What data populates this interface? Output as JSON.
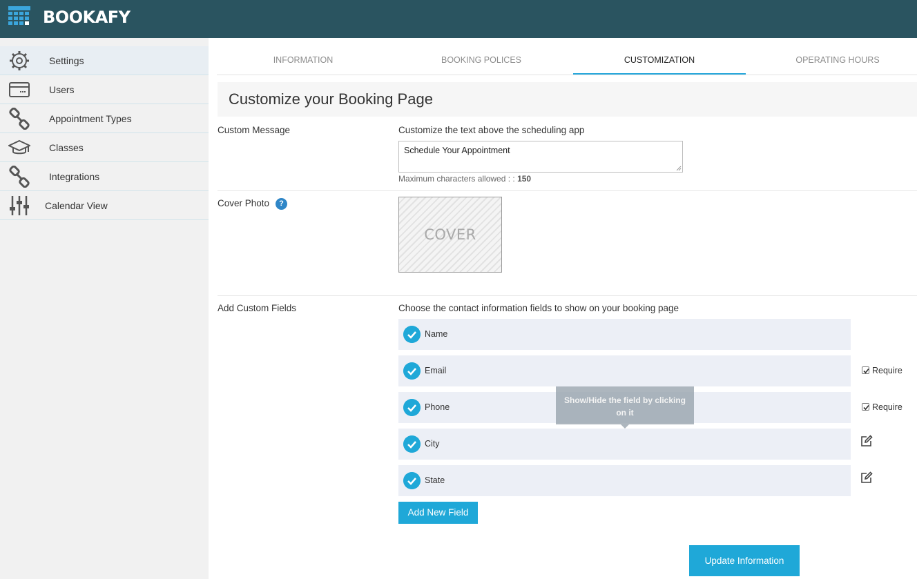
{
  "app": {
    "brand": "BOOKAFY"
  },
  "sidebar": {
    "items": [
      {
        "label": "Settings",
        "icon": "gear-icon"
      },
      {
        "label": "Users",
        "icon": "card-icon"
      },
      {
        "label": "Appointment Types",
        "icon": "link-icon"
      },
      {
        "label": "Classes",
        "icon": "graduation-cap-icon"
      },
      {
        "label": "Integrations",
        "icon": "link-icon"
      },
      {
        "label": "Calendar View",
        "icon": "sliders-icon"
      }
    ]
  },
  "tabs": [
    {
      "label": "INFORMATION"
    },
    {
      "label": "BOOKING POLICES"
    },
    {
      "label": "CUSTOMIZATION"
    },
    {
      "label": "OPERATING HOURS"
    }
  ],
  "page": {
    "title": "Customize your Booking Page",
    "custom_message": {
      "label": "Custom Message",
      "description": "Customize the text above the scheduling app",
      "value": "Schedule Your Appointment",
      "max_note": "Maximum characters allowed : :",
      "max_value": "150"
    },
    "cover_photo": {
      "label": "Cover Photo",
      "help": "?",
      "placeholder": "COVER"
    },
    "custom_fields": {
      "label": "Add Custom Fields",
      "description": "Choose the contact information fields to show on your booking page",
      "fields": [
        {
          "name": "Name"
        },
        {
          "name": "Email",
          "require_label": "Require"
        },
        {
          "name": "Phone",
          "require_label": "Require"
        },
        {
          "name": "City"
        },
        {
          "name": "State"
        }
      ],
      "tooltip": "Show/Hide the field by clicking on it",
      "add_button": "Add New Field"
    },
    "update_button": "Update Information"
  },
  "colors": {
    "header": "#2a5460",
    "accent": "#1fa8d8",
    "field_bg": "#eceff6"
  }
}
